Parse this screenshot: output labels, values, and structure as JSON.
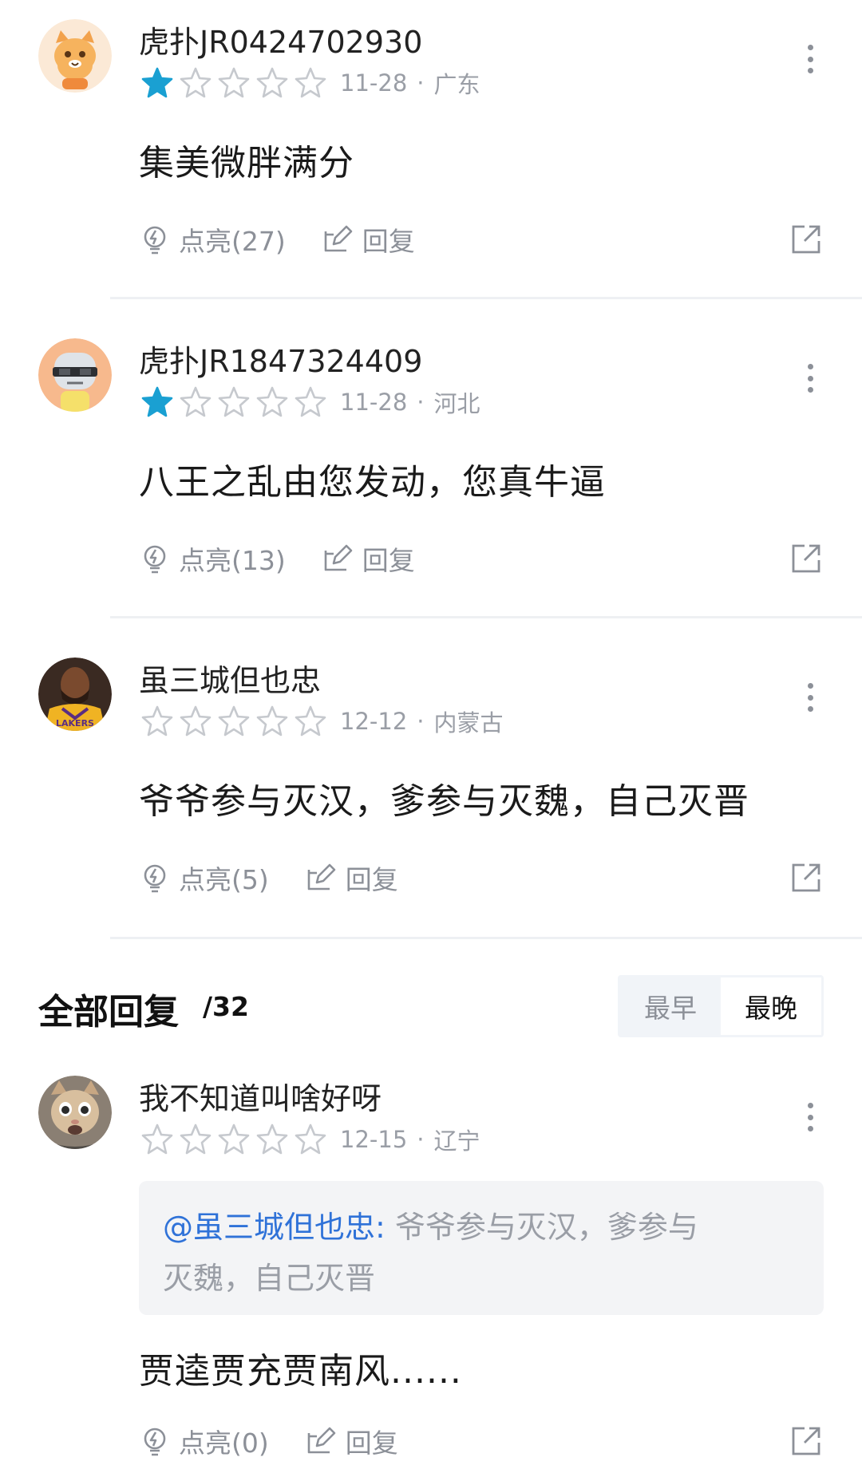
{
  "colors": {
    "star_filled": "#1aa0d2",
    "star_empty": "#c6c9ce",
    "meta_text": "#9a9ea6",
    "action_text": "#8c9098",
    "mention": "#2f72d8",
    "quote_bg": "#f3f4f6"
  },
  "icons": {
    "like": "lightbulb-icon",
    "reply": "edit-reply-icon",
    "share": "share-icon",
    "more": "more-vertical-icon",
    "star": "star-icon"
  },
  "comments": [
    {
      "username": "虎扑JR0424702930",
      "rating": 1,
      "date": "11-28",
      "region": "广东",
      "text": "集美微胖满分",
      "like_label": "点亮(27)",
      "reply_label": "回复"
    },
    {
      "username": "虎扑JR1847324409",
      "rating": 1,
      "date": "11-28",
      "region": "河北",
      "text": "八王之乱由您发动，您真牛逼",
      "like_label": "点亮(13)",
      "reply_label": "回复"
    },
    {
      "username": "虽三城但也忠",
      "rating": 0,
      "date": "12-12",
      "region": "内蒙古",
      "text": "爷爷参与灭汉，爹参与灭魏，自己灭晋",
      "like_label": "点亮(5)",
      "reply_label": "回复"
    }
  ],
  "replies_section": {
    "title": "全部回复",
    "count": "/32",
    "sort_options": [
      "最早",
      "最晚"
    ],
    "sort_selected": "最晚"
  },
  "replies": [
    {
      "username": "我不知道叫啥好呀",
      "rating": 0,
      "date": "12-15",
      "region": "辽宁",
      "quote_mention": "@虽三城但也忠:",
      "quote_line1": " 爷爷参与灭汉，爹参与",
      "quote_line2": "灭魏，自己灭晋",
      "text": "贾逵贾充贾南风......",
      "like_label": "点亮(0)",
      "reply_label": "回复"
    }
  ]
}
